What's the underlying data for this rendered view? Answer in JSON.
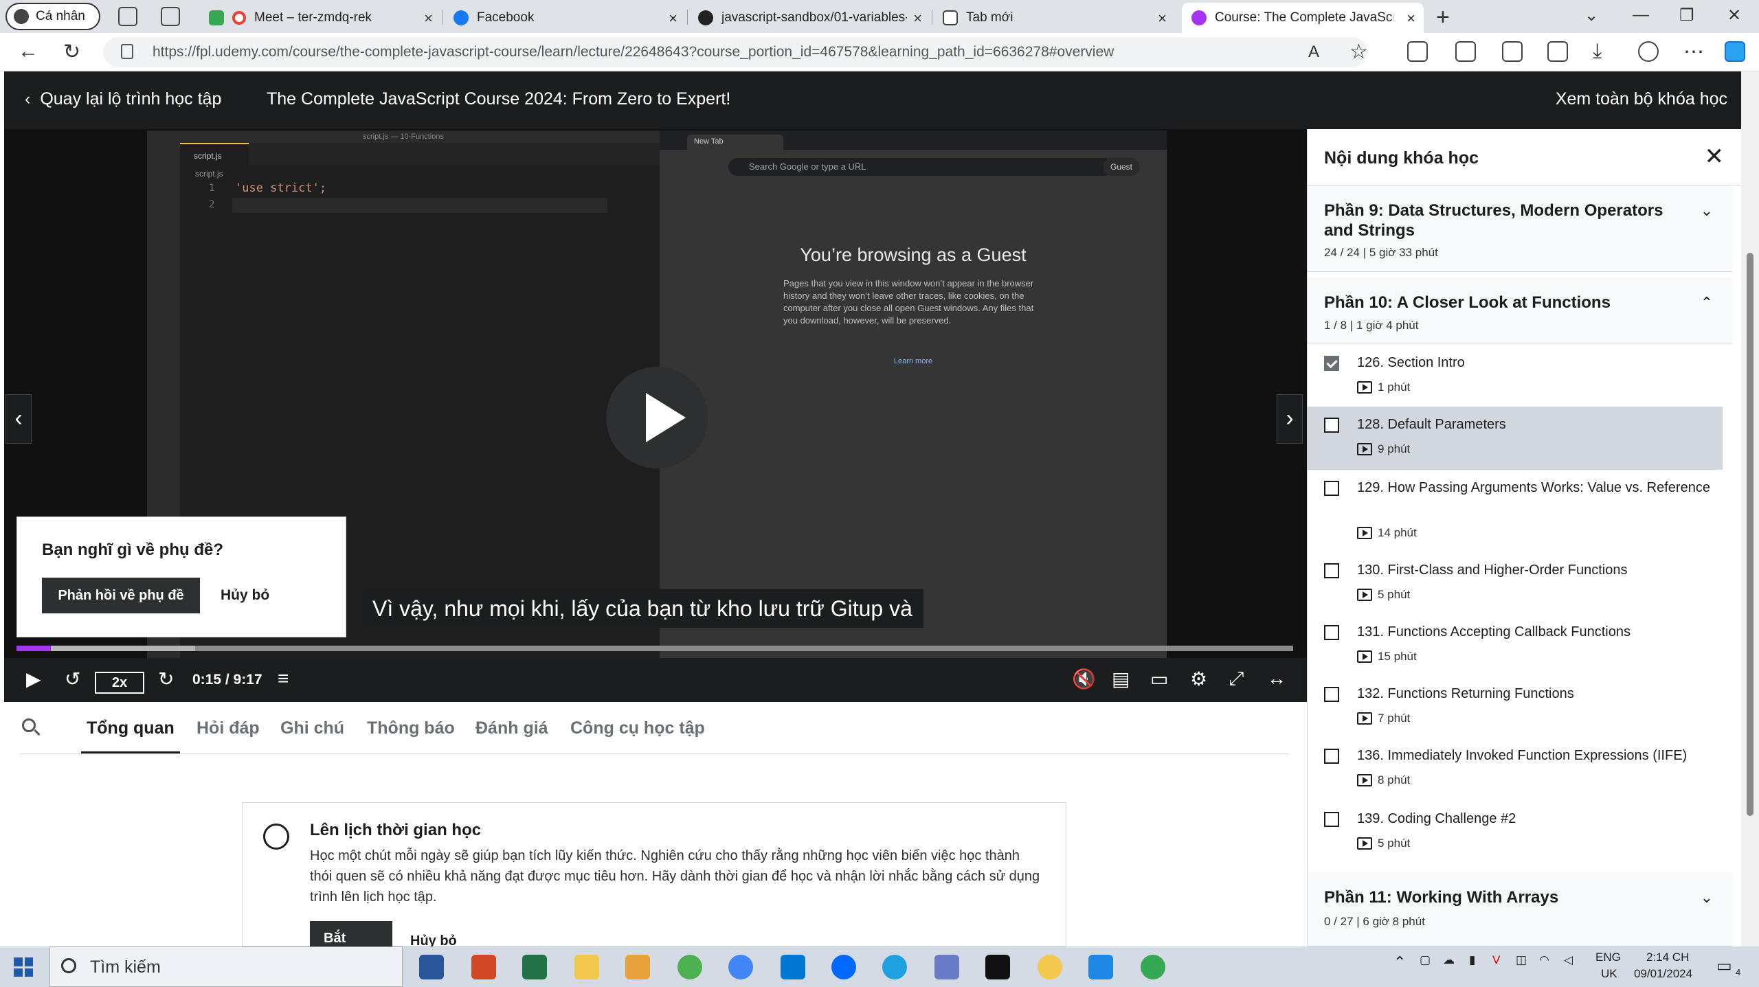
{
  "browser": {
    "profile_label": "Cá nhân",
    "tabs": [
      {
        "label": "Meet – ter-zmdq-rek",
        "color": "#ea4335"
      },
      {
        "label": "Facebook",
        "color": "#1877f2"
      },
      {
        "label": "javascript-sandbox/01-variables-",
        "color": "#222222"
      },
      {
        "label": "Tab mới",
        "color": "#444444"
      },
      {
        "label": "Course: The Complete JavaScript",
        "color": "#a435f0"
      }
    ],
    "url": "https://fpl.udemy.com/course/the-complete-javascript-course/learn/lecture/22648643?course_portion_id=467578&learning_path_id=6636278#overview"
  },
  "header": {
    "back_label": "Quay lại lộ trình học tập",
    "course_title": "The Complete JavaScript Course 2024: From Zero to Expert!",
    "see_all_label": "Xem toàn bộ khóa học"
  },
  "video": {
    "editor": {
      "title": "script.js — 10-Functions",
      "file_tab": "script.js",
      "breadcrumb": "script.js",
      "line1": "'use strict';",
      "line1_no": "1",
      "line2_no": "2"
    },
    "inner_browser": {
      "tab": "New Tab",
      "omnibox": "Search Google or type a URL",
      "guest": "Guest",
      "heading": "You’re browsing as a Guest",
      "body": "Pages that you view in this window won’t appear in the browser history and they won’t leave other traces, like cookies, on the computer after you close all open Guest windows. Any files that you download, however, will be preserved.",
      "link": "Learn more"
    },
    "feedback_prompt": {
      "question": "Bạn nghĩ gì về phụ đề?",
      "primary": "Phản hồi về phụ đề",
      "secondary": "Hủy bỏ"
    },
    "caption": "Vì vậy, như mọi khi, lấy của bạn từ kho lưu trữ Gitup và",
    "speed": "2x",
    "time": "0:15 / 9:17",
    "progress": 0.027,
    "accent": "#a435f0"
  },
  "sidebar": {
    "title": "Nội dung khóa học",
    "sections": [
      {
        "title": "Phần 9: Data Structures, Modern Operators and Strings",
        "meta": "24 / 24 | 5 giờ 33 phút"
      },
      {
        "title": "Phần 10: A Closer Look at Functions",
        "meta": "1 / 8 | 1 giờ 4 phút"
      },
      {
        "title": "Phần 11: Working With Arrays",
        "meta": "0 / 27 | 6 giờ 8 phút"
      }
    ],
    "lectures": [
      {
        "title": "126. Section Intro",
        "duration": "1 phút",
        "done": true
      },
      {
        "title": "128. Default Parameters",
        "duration": "9 phút",
        "current": true
      },
      {
        "title": "129. How Passing Arguments Works: Value vs. Reference",
        "duration": "14 phút"
      },
      {
        "title": "130. First-Class and Higher-Order Functions",
        "duration": "5 phút"
      },
      {
        "title": "131. Functions Accepting Callback Functions",
        "duration": "15 phút"
      },
      {
        "title": "132. Functions Returning Functions",
        "duration": "7 phút"
      },
      {
        "title": "136. Immediately Invoked Function Expressions (IIFE)",
        "duration": "8 phút"
      },
      {
        "title": "139. Coding Challenge #2",
        "duration": "5 phút"
      }
    ]
  },
  "lower_tabs": [
    "Tổng quan",
    "Hỏi đáp",
    "Ghi chú",
    "Thông báo",
    "Đánh giá",
    "Công cụ học tập"
  ],
  "schedule": {
    "title": "Lên lịch thời gian học",
    "body": "Học một chút mỗi ngày sẽ giúp bạn tích lũy kiến thức. Nghiên cứu cho thấy rằng những học viên biến việc học thành thói quen sẽ có nhiều khả năng đạt được mục tiêu hơn. Hãy dành thời gian để học và nhận lời nhắc bằng cách sử dụng trình lên lịch học tập.",
    "start": "Bắt đầu",
    "cancel": "Hủy bỏ"
  },
  "taskbar": {
    "search": "Tìm kiếm",
    "lang1": "ENG",
    "lang2": "UK",
    "time": "2:14 CH",
    "date": "09/01/2024",
    "notifications": "4"
  }
}
